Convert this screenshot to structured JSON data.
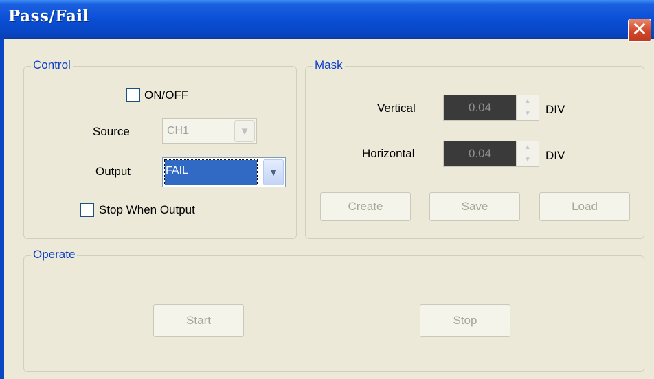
{
  "window": {
    "title": "Pass/Fail",
    "close_symbol": "✕"
  },
  "control": {
    "legend": "Control",
    "on_off_label": "ON/OFF",
    "source_label": "Source",
    "source_value": "CH1",
    "output_label": "Output",
    "output_value": "FAIL",
    "stop_when_output_label": "Stop When Output"
  },
  "mask": {
    "legend": "Mask",
    "vertical_label": "Vertical",
    "vertical_value": "0.04",
    "vertical_unit": "DIV",
    "horizontal_label": "Horizontal",
    "horizontal_value": "0.04",
    "horizontal_unit": "DIV",
    "create_label": "Create",
    "save_label": "Save",
    "load_label": "Load"
  },
  "operate": {
    "legend": "Operate",
    "start_label": "Start",
    "stop_label": "Stop"
  },
  "icons": {
    "dropdown": "chevron-down-icon",
    "spin_up": "caret-up-icon",
    "spin_down": "caret-down-icon"
  },
  "colors": {
    "titlebar": "#0a4fd6",
    "close": "#d2462a",
    "legend_text": "#0a3ec8",
    "selection": "#316ac5",
    "dialog_bg": "#ece9d8"
  }
}
